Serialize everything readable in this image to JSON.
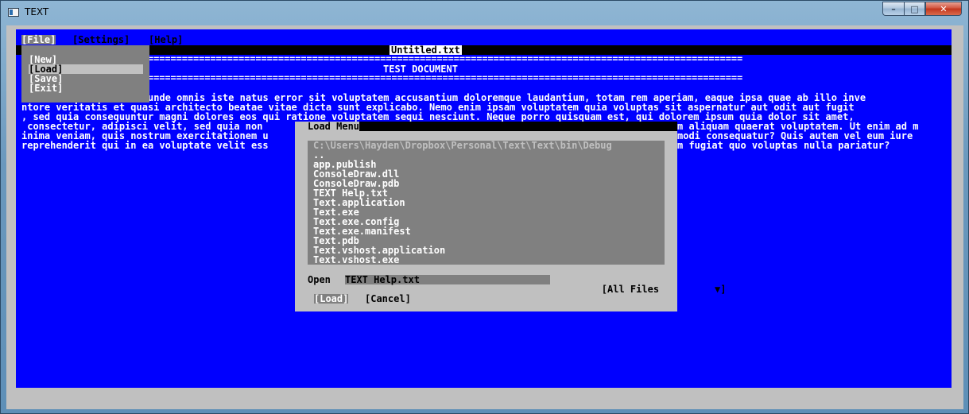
{
  "window": {
    "title": "TEXT",
    "minimize_glyph": "–",
    "maximize_glyph": "□",
    "close_glyph": "✕"
  },
  "menubar": {
    "file": "[File]",
    "settings": "[Settings]",
    "help": "[Help]"
  },
  "file_menu": {
    "items": [
      "[New]",
      "[Load]",
      "[Save]",
      "[Exit]"
    ],
    "selected": "[Load]"
  },
  "document": {
    "filename": "Untitled.txt",
    "heading": "TEST DOCUMENT",
    "rule": "=========================================================================================================",
    "lines": [
      "unde omnis iste natus error sit voluptatem accusantium doloremque laudantium, totam rem aperiam, eaque ipsa quae ab illo inve",
      "ntore veritatis et quasi architecto beatae vitae dicta sunt explicabo. Nemo enim ipsam voluptatem quia voluptas sit aspernatur aut odit aut fugit",
      ", sed quia consequuntur magni dolores eos qui ratione voluptatem sequi nesciunt. Neque porro quisquam est, qui dolorem ipsum quia dolor sit amet,",
      " consectetur, adipisci velit, sed quia non",
      "inima veniam, quis nostrum exercitationem u",
      "reprehenderit qui in ea voluptate velit ess"
    ],
    "lines_right": [
      "m aliquam quaerat voluptatem. Ut enim ad m",
      "modi consequatur? Quis autem vel eum iure",
      "m fugiat quo voluptas nulla pariatur?"
    ]
  },
  "load_dialog": {
    "title": "Load Menu",
    "path": "C:\\Users\\Hayden\\Dropbox\\Personal\\Text\\Text\\bin\\Debug",
    "files": [
      "..",
      "app.publish",
      "ConsoleDraw.dll",
      "ConsoleDraw.pdb",
      "TEXT Help.txt",
      "Text.application",
      "Text.exe",
      "Text.exe.config",
      "Text.exe.manifest",
      "Text.pdb",
      "Text.vshost.application",
      "Text.vshost.exe"
    ],
    "open_label": "Open",
    "open_value": "TEXT Help.txt",
    "filter": "[All Files",
    "filter_arrow": "▼]",
    "load_button": "[Load]",
    "cancel_button": "[Cancel]"
  }
}
